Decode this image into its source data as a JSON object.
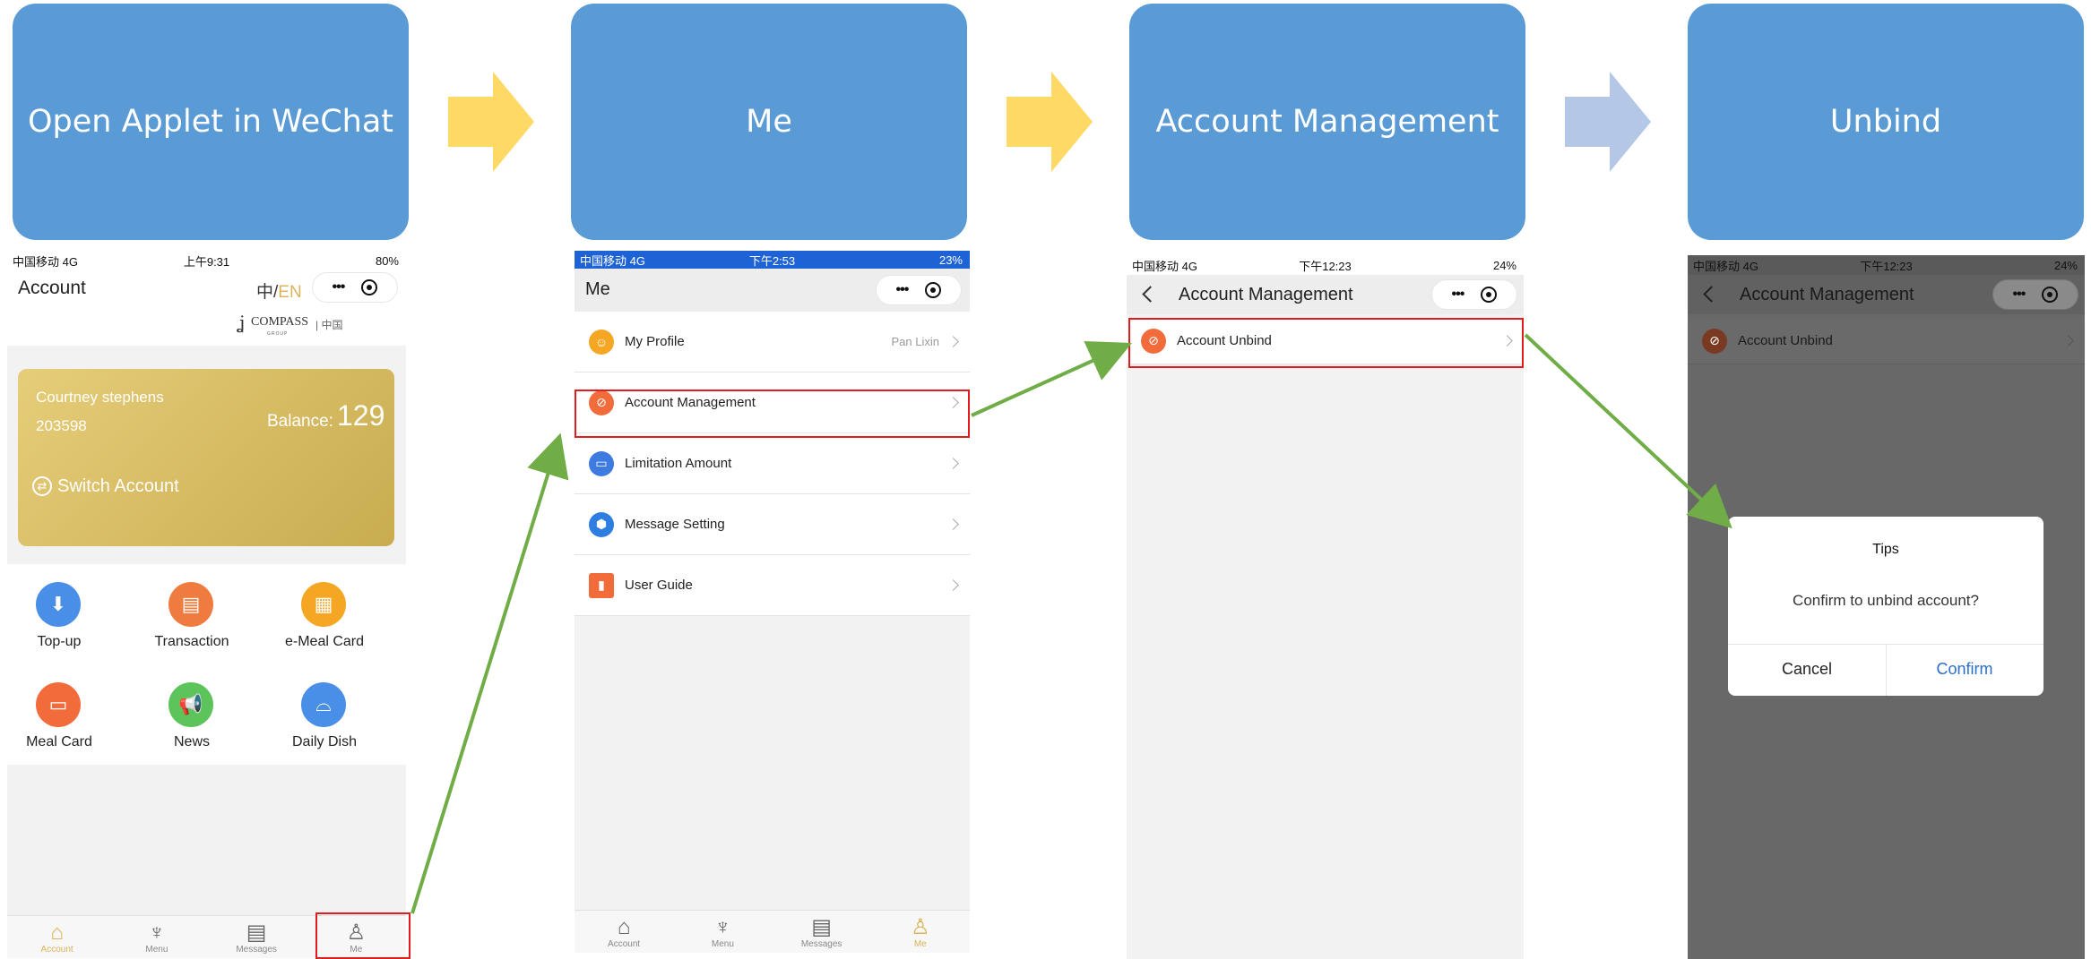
{
  "steps": [
    "Open Applet in WeChat",
    "Me",
    "Account Management",
    "Unbind"
  ],
  "colors": {
    "step_box": "#5b9bd5",
    "arrow_yellow": "#ffd966",
    "arrow_light": "#b4c7e7",
    "flow_arrow": "#70ad47",
    "highlight": "#e11c1c",
    "accent_gold": "#d9b45a"
  },
  "screen1": {
    "status": {
      "carrier": "中国移动 4G",
      "time": "上午9:31",
      "battery": "80%"
    },
    "title": "Account",
    "lang_zh": "中/",
    "lang_en": "EN",
    "logo_text": "COMPASS",
    "logo_sub": "| 中国",
    "logo_group": "GROUP",
    "card": {
      "name": "Courtney stephens",
      "id": "203598",
      "balance_label": "Balance:",
      "balance_value": "129",
      "switch": "Switch Account"
    },
    "grid": [
      {
        "label": "Top-up",
        "icon": "topup-icon",
        "color": "#4a8fe7"
      },
      {
        "label": "Transaction",
        "icon": "transaction-icon",
        "color": "#f07b3f"
      },
      {
        "label": "e-Meal Card",
        "icon": "qrcode-icon",
        "color": "#f5a623"
      },
      {
        "label": "Meal Card",
        "icon": "wallet-icon",
        "color": "#f26b3a"
      },
      {
        "label": "News",
        "icon": "megaphone-icon",
        "color": "#5cc45a"
      },
      {
        "label": "Daily Dish",
        "icon": "cloche-icon",
        "color": "#4a8fe7"
      }
    ],
    "tabs": [
      "Account",
      "Menu",
      "Messages",
      "Me"
    ]
  },
  "screen2": {
    "status": {
      "carrier": "中国移动 4G",
      "time": "下午2:53",
      "battery": "23%"
    },
    "title": "Me",
    "rows": [
      {
        "label": "My Profile",
        "value": "Pan Lixin",
        "icon": "profile-icon",
        "color": "#f5a623"
      },
      {
        "label": "Account Management",
        "value": "",
        "icon": "account-icon",
        "color": "#f26b3a"
      },
      {
        "label": "Limitation Amount",
        "value": "",
        "icon": "card-icon",
        "color": "#3d7be0"
      },
      {
        "label": "Message Setting",
        "value": "",
        "icon": "hexagon-icon",
        "color": "#2e7de0"
      },
      {
        "label": "User Guide",
        "value": "",
        "icon": "book-icon",
        "color": "#f26b3a"
      }
    ],
    "tabs": [
      "Account",
      "Menu",
      "Messages",
      "Me"
    ]
  },
  "screen3": {
    "status": {
      "carrier": "中国移动 4G",
      "time": "下午12:23",
      "battery": "24%"
    },
    "title": "Account Management",
    "row": "Account Unbind"
  },
  "screen4": {
    "status": {
      "carrier": "中国移动 4G",
      "time": "下午12:23",
      "battery": "24%"
    },
    "title": "Account Management",
    "row": "Account Unbind",
    "dialog": {
      "title": "Tips",
      "message": "Confirm to unbind account?",
      "cancel": "Cancel",
      "confirm": "Confirm"
    }
  }
}
